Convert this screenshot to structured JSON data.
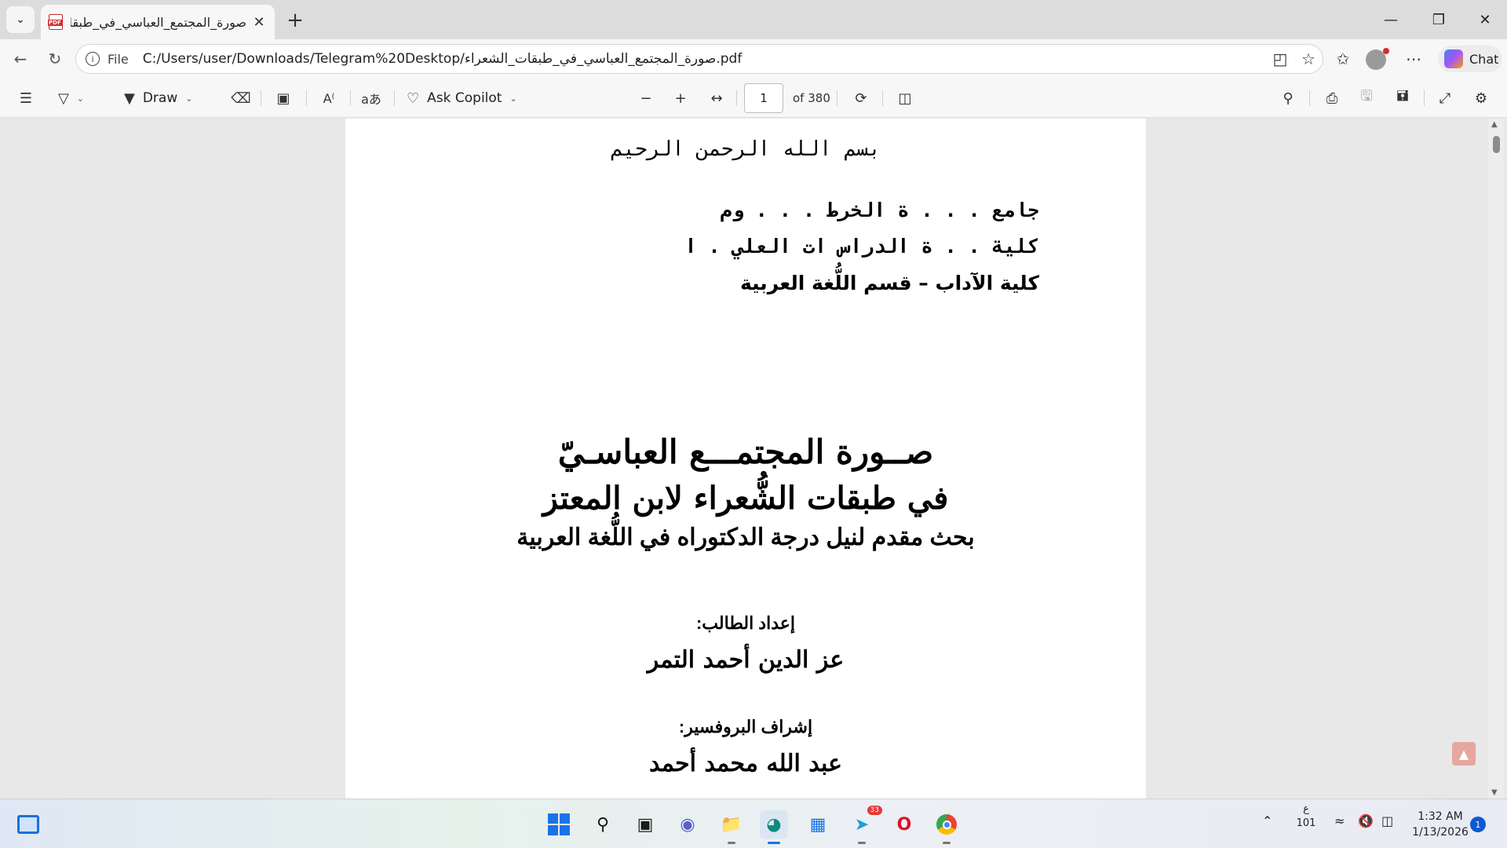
{
  "browser": {
    "tab_title": "صورة_المجتمع_العباسي_في_طبقات_",
    "pdf_badge": "PDF",
    "scheme_label": "File",
    "url": "C:/Users/user/Downloads/Telegram%20Desktop/صورة_المجتمع_العباسي_في_طبقات_الشعراء.pdf",
    "chat_label": "Chat"
  },
  "pdf_toolbar": {
    "draw_label": "Draw",
    "ask_copilot_label": "Ask Copilot",
    "page_number": "1",
    "page_total": "of 380"
  },
  "document": {
    "basmala": "بسم  الله  الرحمن  الرحيم",
    "university": "جامع . . . ة  الخرط . . . وم",
    "graduate_college": "كلية . . ة الدراس ات العلي . ا",
    "faculty": "كلية الآداب – قسم اللُّغة العربية",
    "title_line1": "صــورة المجتمـــع العباسـيّ",
    "title_line2": "في طبقات الشُّعراء لابن المعتز",
    "subtitle": "بحث مقدم لنيل درجة الدكتوراه في اللُّغة العربية",
    "prepared_by_label": "إعداد الطالب:",
    "student_name": "عز الدين أحمد التمر",
    "supervisor_label": "إشراف البروفسير:",
    "supervisor_name": "عبد الله محمد أحمد"
  },
  "taskbar": {
    "telegram_badge": "33",
    "language": "ع",
    "language_sub": "101",
    "time": "1:32 AM",
    "date": "1/13/2026",
    "notification_count": "1"
  },
  "icons": [
    "chevron-down-icon",
    "pdf-icon",
    "close-icon",
    "plus-icon",
    "minimize-icon",
    "maximize-icon",
    "back-icon",
    "refresh-icon",
    "info-icon",
    "read-aloud-icon",
    "star-icon",
    "favorites-icon",
    "more-icon",
    "copilot-icon",
    "contents-icon",
    "highlight-icon",
    "draw-icon",
    "eraser-icon",
    "text-box-icon",
    "read-aloud-icon",
    "translate-icon",
    "zoom-out-icon",
    "zoom-in-icon",
    "fit-width-icon",
    "rotate-icon",
    "two-page-icon",
    "search-icon",
    "print-icon",
    "save-icon",
    "save-as-icon",
    "fullscreen-icon",
    "settings-icon",
    "windows-start-icon",
    "search-icon",
    "task-view-icon",
    "teams-icon",
    "file-explorer-icon",
    "edge-icon",
    "store-icon",
    "telegram-icon",
    "opera-icon",
    "chrome-icon",
    "wifi-icon",
    "mute-icon",
    "battery-icon"
  ]
}
